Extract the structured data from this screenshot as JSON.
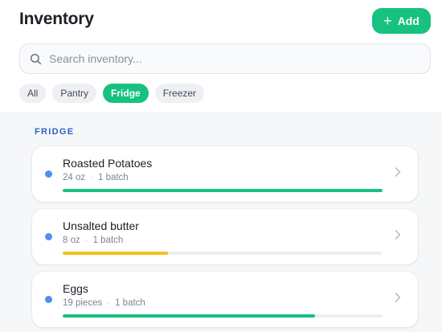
{
  "header": {
    "title": "Inventory",
    "add_label": "Add",
    "accent_color": "#17c17f"
  },
  "search": {
    "placeholder": "Search inventory...",
    "value": ""
  },
  "filters": [
    {
      "label": "All",
      "active": false
    },
    {
      "label": "Pantry",
      "active": false
    },
    {
      "label": "Fridge",
      "active": true
    },
    {
      "label": "Freezer",
      "active": false
    }
  ],
  "section": {
    "label": "FRIDGE"
  },
  "items": [
    {
      "name": "Roasted Potatoes",
      "quantity": "24 oz",
      "batches": "1 batch",
      "level": 1.0,
      "bar_color": "#17c17f",
      "dot_color": "#4d90f0"
    },
    {
      "name": "Unsalted butter",
      "quantity": "8 oz",
      "batches": "1 batch",
      "level": 0.33,
      "bar_color": "#f2c21b",
      "dot_color": "#4d90f0"
    },
    {
      "name": "Eggs",
      "quantity": "19 pieces",
      "batches": "1 batch",
      "level": 0.79,
      "bar_color": "#17c17f",
      "dot_color": "#4d90f0"
    }
  ],
  "icons": {
    "add": "plus-icon",
    "search": "search-icon",
    "item_action": "chevron-right-icon"
  }
}
